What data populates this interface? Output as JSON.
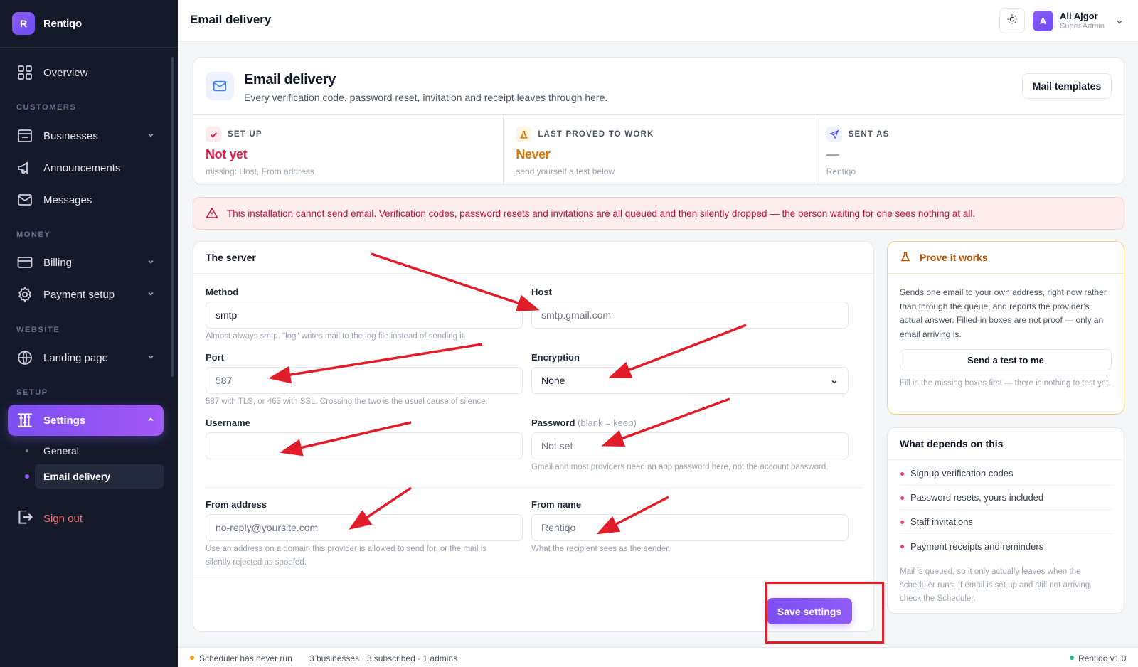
{
  "app": {
    "name": "Rentiqo",
    "logo_letter": "R"
  },
  "sidebar": {
    "overview": "Overview",
    "sections": {
      "customers": "CUSTOMERS",
      "money": "MONEY",
      "website": "WEBSITE",
      "setup": "SETUP"
    },
    "businesses": "Businesses",
    "announcements": "Announcements",
    "messages": "Messages",
    "billing": "Billing",
    "payment_setup": "Payment setup",
    "landing_page": "Landing page",
    "settings": "Settings",
    "settings_sub": {
      "general": "General",
      "email_delivery": "Email delivery"
    },
    "sign_out": "Sign out"
  },
  "topbar": {
    "title": "Email delivery",
    "user": {
      "initial": "A",
      "name": "Ali Ajgor",
      "role": "Super Admin"
    }
  },
  "header": {
    "title": "Email delivery",
    "subtitle": "Every verification code, password reset, invitation and receipt leaves through here.",
    "mail_templates": "Mail templates"
  },
  "stats": [
    {
      "label": "SET UP",
      "value": "Not yet",
      "note": "missing: Host, From address",
      "color": "#e11d48"
    },
    {
      "label": "LAST PROVED TO WORK",
      "value": "Never",
      "note": "send yourself a test below",
      "color": "#d97706"
    },
    {
      "label": "SENT AS",
      "value": "—",
      "note": "Rentiqo",
      "color": "#9ca3af"
    }
  ],
  "alert": "This installation cannot send email. Verification codes, password resets and invitations are all queued and then silently dropped — the person waiting for one sees nothing at all.",
  "server": {
    "title": "The server",
    "method": {
      "label": "Method",
      "value": "smtp",
      "hint": "Almost always smtp. \"log\" writes mail to the log file instead of sending it."
    },
    "host": {
      "label": "Host",
      "placeholder": "smtp.gmail.com"
    },
    "port": {
      "label": "Port",
      "placeholder": "587",
      "hint": "587 with TLS, or 465 with SSL. Crossing the two is the usual cause of silence."
    },
    "encryption": {
      "label": "Encryption",
      "value": "None"
    },
    "username": {
      "label": "Username",
      "value": ""
    },
    "password": {
      "label": "Password",
      "label_note": "(blank = keep)",
      "placeholder": "Not set",
      "hint": "Gmail and most providers need an app password here, not the account password."
    },
    "from_address": {
      "label": "From address",
      "placeholder": "no-reply@yoursite.com",
      "hint": "Use an address on a domain this provider is allowed to send for, or the mail is silently rejected as spoofed."
    },
    "from_name": {
      "label": "From name",
      "placeholder": "Rentiqo",
      "hint": "What the recipient sees as the sender."
    },
    "save": "Save settings"
  },
  "prove": {
    "title": "Prove it works",
    "text": "Sends one email to your own address, right now rather than through the queue, and reports the provider's actual answer. Filled-in boxes are not proof — only an email arriving is.",
    "button": "Send a test to me",
    "note": "Fill in the missing boxes first — there is nothing to test yet."
  },
  "depends": {
    "title": "What depends on this",
    "items": [
      "Signup verification codes",
      "Password resets, yours included",
      "Staff invitations",
      "Payment receipts and reminders"
    ],
    "note": "Mail is queued, so it only actually leaves when the scheduler runs. If email is set up and still not arriving, check the Scheduler."
  },
  "footer": {
    "scheduler": "Scheduler has never run",
    "counts": "3 businesses · 3 subscribed · 1 admins",
    "version": "Rentiqo v1.0"
  },
  "colors": {
    "accent": "#7c4ff0",
    "danger": "#e11d48",
    "warning": "#d97706",
    "annotation": "#e11d2a"
  }
}
